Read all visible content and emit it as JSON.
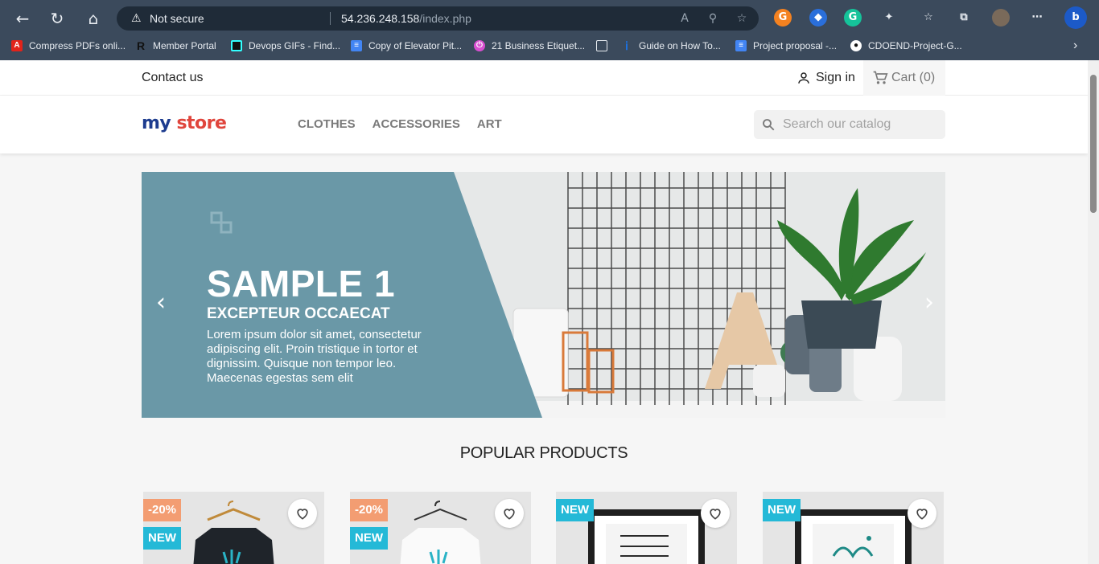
{
  "browser": {
    "security_label": "Not secure",
    "url_host": "54.236.248.158",
    "url_path": "/index.php",
    "bookmarks": [
      {
        "label": "Compress PDFs onli...",
        "icon": "adobe-icon",
        "color": "#e2231a"
      },
      {
        "label": "Member Portal",
        "icon": "r-icon",
        "color": "#3b4a5c"
      },
      {
        "label": "Devops GIFs - Find...",
        "icon": "giphy-icon",
        "color": "#121212"
      },
      {
        "label": "Copy of Elevator Pit...",
        "icon": "docs-icon",
        "color": "#4285f4"
      },
      {
        "label": "21 Business Etiquet...",
        "icon": "power-icon",
        "color": "#d94fd1"
      },
      {
        "label": "",
        "icon": "page-icon",
        "color": "#3b4a5c"
      },
      {
        "label": "Guide on How To...",
        "icon": "info-icon",
        "color": "#1a73e8"
      },
      {
        "label": "Project proposal -...",
        "icon": "docs-icon",
        "color": "#4285f4"
      },
      {
        "label": "CDOEND-Project-G...",
        "icon": "github-icon",
        "color": "#ffffff"
      }
    ]
  },
  "topnav": {
    "contact": "Contact us",
    "signin": "Sign in",
    "cart": "Cart (0)"
  },
  "header": {
    "logo_part1": "my",
    "logo_part2": "store",
    "menu": [
      "CLOTHES",
      "ACCESSORIES",
      "ART"
    ],
    "search_placeholder": "Search our catalog"
  },
  "hero": {
    "title": "SAMPLE 1",
    "subtitle": "EXCEPTEUR OCCAECAT",
    "description": "Lorem ipsum dolor sit amet, consectetur adipiscing elit. Proin tristique in tortor et dignissim. Quisque non tempor leo. Maecenas egestas sem elit",
    "panel_color": "#6a98a7"
  },
  "section_title": "POPULAR PRODUCTS",
  "products": [
    {
      "discount": "-20%",
      "new": "NEW"
    },
    {
      "discount": "-20%",
      "new": "NEW"
    },
    {
      "discount": "",
      "new": "NEW"
    },
    {
      "discount": "",
      "new": "NEW"
    }
  ],
  "colors": {
    "accent": "#24b9d7",
    "discount": "#f39d72"
  }
}
